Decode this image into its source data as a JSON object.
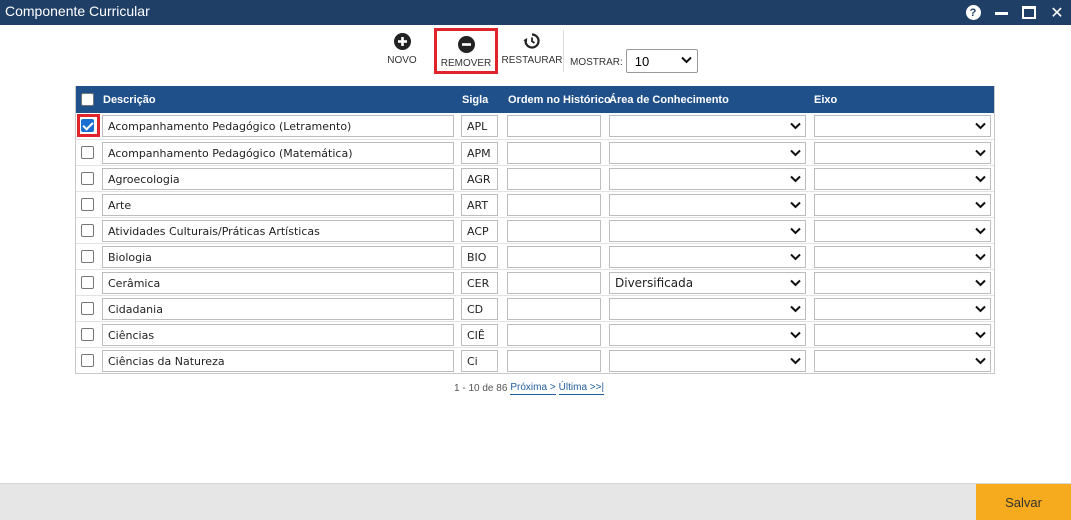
{
  "window": {
    "title": "Componente Curricular",
    "colors": {
      "titlebar": "#1f3f66",
      "header": "#1f5089",
      "highlight": "#e0242b",
      "save": "#f5ab1d"
    },
    "icons": [
      "help-icon",
      "minimize-icon",
      "maximize-icon",
      "close-icon"
    ]
  },
  "toolbar": {
    "novo_label": "NOVO",
    "remover_label": "REMOVER",
    "restaurar_label": "RESTAURAR",
    "mostrar_label": "MOSTRAR:",
    "mostrar_value": "10"
  },
  "table": {
    "headers": {
      "descricao": "Descrição",
      "sigla": "Sigla",
      "ordem": "Ordem no Histórico",
      "area": "Área de Conhecimento",
      "eixo": "Eixo"
    },
    "rows": [
      {
        "checked": true,
        "descricao": "Acompanhamento Pedagógico (Letramento)",
        "sigla": "APL",
        "ordem": "",
        "area": "",
        "eixo": ""
      },
      {
        "checked": false,
        "descricao": "Acompanhamento Pedagógico (Matemática)",
        "sigla": "APM",
        "ordem": "",
        "area": "",
        "eixo": ""
      },
      {
        "checked": false,
        "descricao": "Agroecologia",
        "sigla": "AGR",
        "ordem": "",
        "area": "",
        "eixo": ""
      },
      {
        "checked": false,
        "descricao": "Arte",
        "sigla": "ART",
        "ordem": "",
        "area": "",
        "eixo": ""
      },
      {
        "checked": false,
        "descricao": "Atividades Culturais/Práticas Artísticas",
        "sigla": "ACP",
        "ordem": "",
        "area": "",
        "eixo": ""
      },
      {
        "checked": false,
        "descricao": "Biologia",
        "sigla": "BIO",
        "ordem": "",
        "area": "",
        "eixo": ""
      },
      {
        "checked": false,
        "descricao": "Cerâmica",
        "sigla": "CER",
        "ordem": "",
        "area": "Diversificada",
        "eixo": ""
      },
      {
        "checked": false,
        "descricao": "Cidadania",
        "sigla": "CD",
        "ordem": "",
        "area": "",
        "eixo": ""
      },
      {
        "checked": false,
        "descricao": "Ciências",
        "sigla": "CIÊ",
        "ordem": "",
        "area": "",
        "eixo": ""
      },
      {
        "checked": false,
        "descricao": "Ciências da Natureza",
        "sigla": "Ci",
        "ordem": "",
        "area": "",
        "eixo": ""
      }
    ]
  },
  "pager": {
    "range": "1 - 10 de 86",
    "next": "Próxima >",
    "last": "Última >>|"
  },
  "footer": {
    "save_label": "Salvar"
  }
}
